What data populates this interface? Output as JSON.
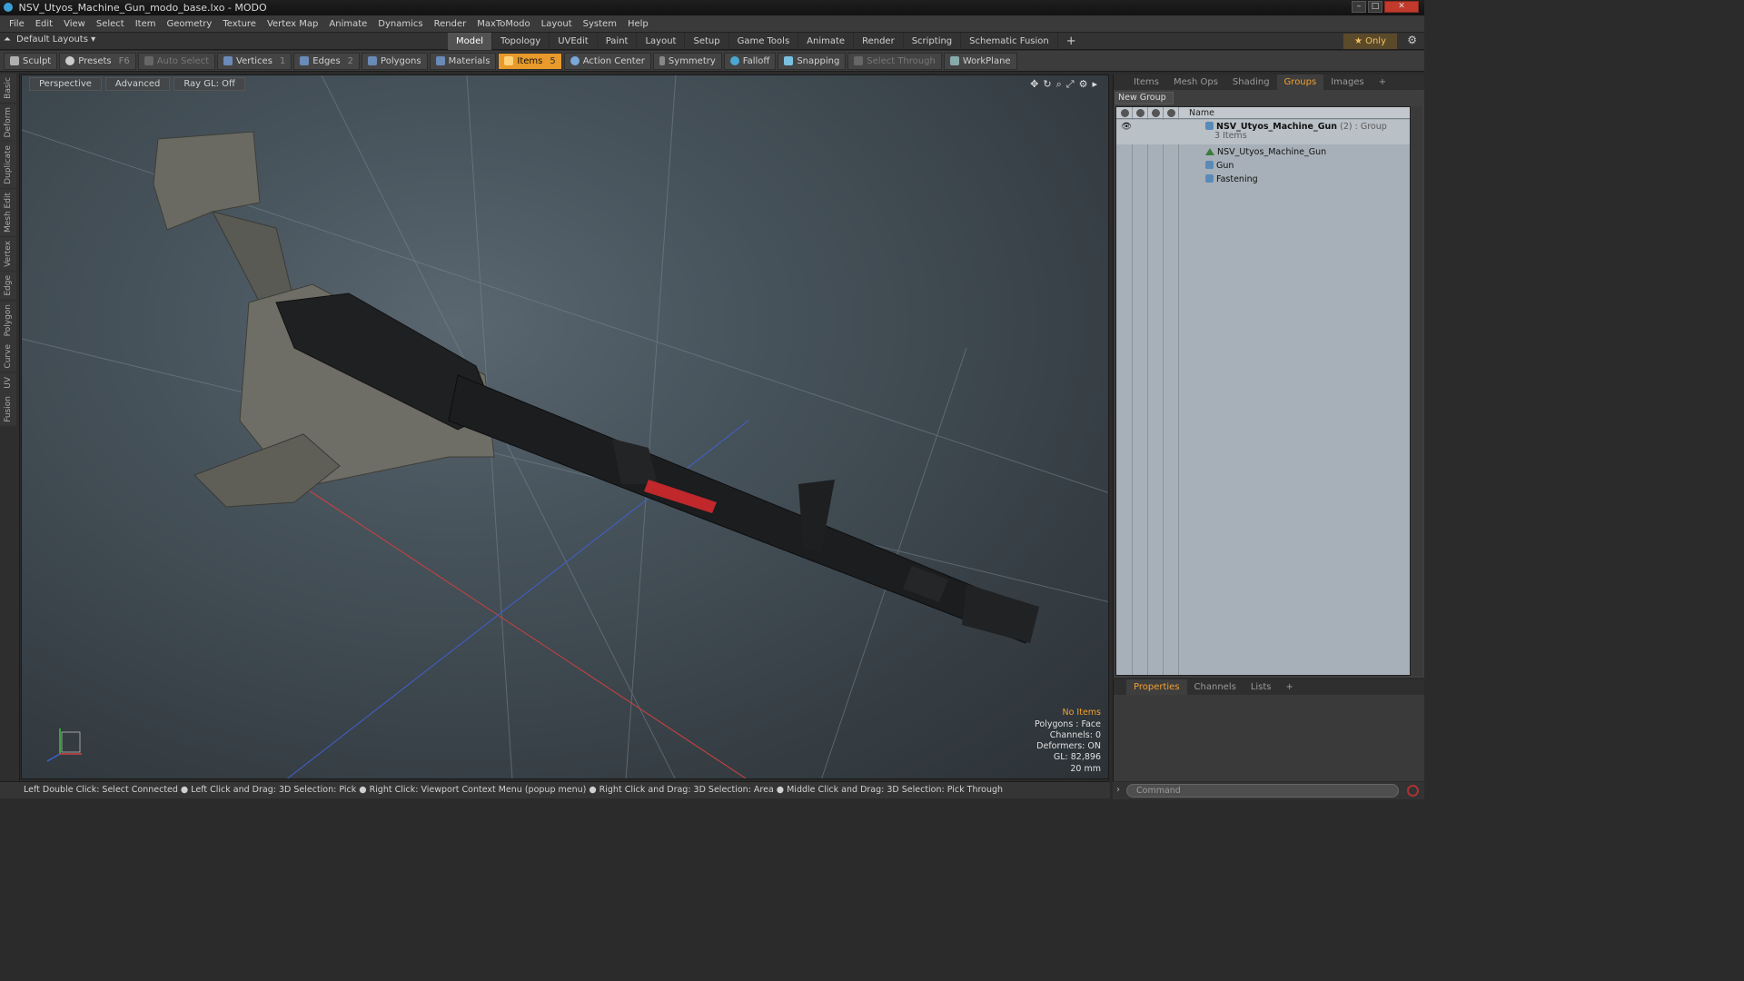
{
  "window": {
    "title": "NSV_Utyos_Machine_Gun_modo_base.lxo - MODO"
  },
  "menu": [
    "File",
    "Edit",
    "View",
    "Select",
    "Item",
    "Geometry",
    "Texture",
    "Vertex Map",
    "Animate",
    "Dynamics",
    "Render",
    "MaxToModo",
    "Layout",
    "System",
    "Help"
  ],
  "layout_bar": {
    "default_layouts": "Default Layouts ▾",
    "tabs": [
      "Model",
      "Topology",
      "UVEdit",
      "Paint",
      "Layout",
      "Setup",
      "Game Tools",
      "Animate",
      "Render",
      "Scripting",
      "Schematic Fusion"
    ],
    "active_tab": "Model",
    "only_label": "★ Only"
  },
  "toolbar": {
    "sculpt": "Sculpt",
    "presets": "Presets",
    "presets_key": "F6",
    "auto_select": "Auto Select",
    "vertices": "Vertices",
    "vertices_count": "1",
    "edges": "Edges",
    "edges_count": "2",
    "polygons": "Polygons",
    "materials": "Materials",
    "items": "Items",
    "items_count": "5",
    "action_center": "Action Center",
    "symmetry": "Symmetry",
    "falloff": "Falloff",
    "snapping": "Snapping",
    "select_through": "Select Through",
    "workplane": "WorkPlane"
  },
  "side_tabs": [
    "Basic",
    "Deform",
    "Duplicate",
    "Mesh Edit",
    "Vertex",
    "Edge",
    "Polygon",
    "Curve",
    "UV",
    "Fusion"
  ],
  "viewport": {
    "view": "Perspective",
    "shading": "Advanced",
    "raygl": "Ray GL: Off",
    "stats": {
      "items": "No Items",
      "polygons": "Polygons : Face",
      "channels": "Channels: 0",
      "deformers": "Deformers: ON",
      "gl": "GL: 82,896",
      "scale": "20 mm"
    }
  },
  "statusbar": "Left Double Click: Select Connected ● Left Click and Drag: 3D Selection: Pick ● Right Click: Viewport Context Menu (popup menu) ● Right Click and Drag: 3D Selection: Area ● Middle Click and Drag: 3D Selection: Pick Through",
  "right_panel": {
    "tabs": [
      "Items",
      "Mesh Ops",
      "Shading",
      "Groups",
      "Images",
      "+"
    ],
    "active_tab": "Groups",
    "new_group": "New Group",
    "column_name": "Name",
    "group": {
      "name": "NSV_Utyos_Machine_Gun",
      "count": "(2)",
      "type": ": Group",
      "items": "3 Items"
    },
    "children": [
      "NSV_Utyos_Machine_Gun",
      "Gun",
      "Fastening"
    ]
  },
  "bottom_panel": {
    "tabs": [
      "Properties",
      "Channels",
      "Lists",
      "+"
    ],
    "active_tab": "Properties"
  },
  "command": {
    "placeholder": "Command"
  },
  "colors": {
    "accent": "#e89a2a",
    "x_axis": "#d04040",
    "y_axis": "#40c040",
    "z_axis": "#4060d0"
  }
}
